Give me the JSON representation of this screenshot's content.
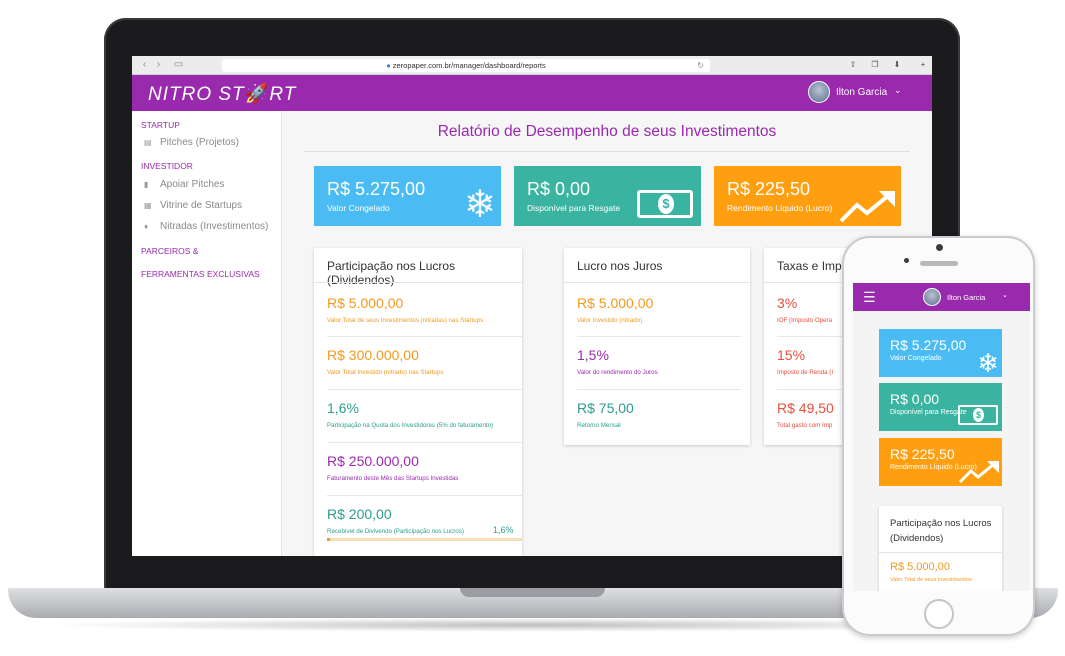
{
  "browser": {
    "url": "zeropaper.com.br/manager/dashboard/reports",
    "back_icon": "chevron-left",
    "forward_icon": "chevron-right"
  },
  "header": {
    "logo": "NITRO ST",
    "logo_rocket": "🚀",
    "logo_end": "RT",
    "user_name": "Ilton Garcia",
    "accent": "#9a2aad"
  },
  "sidebar": {
    "sections": [
      {
        "label": "STARTUP"
      },
      {
        "label": "INVESTIDOR"
      },
      {
        "label": "PARCEIROS &"
      },
      {
        "label": "FERRAMENTAS EXCLUSIVAS"
      }
    ],
    "items": [
      {
        "label": "Pitches (Projetos)",
        "icon": "document-icon"
      },
      {
        "label": "Apoiar Pitches",
        "icon": "thumbs-up-icon"
      },
      {
        "label": "Vitrine de Startups",
        "icon": "grid-icon"
      },
      {
        "label": "Nitradas (Investimentos)",
        "icon": "flame-icon"
      }
    ]
  },
  "main": {
    "title": "Relatório de Desempenho de seus Investimentos",
    "stat_cards": [
      {
        "value": "R$ 5.275,00",
        "label": "Valor Congelado",
        "color": "#4bbcf3",
        "icon": "snowflake-icon"
      },
      {
        "value": "R$ 0,00",
        "label": "Disponível para Resgate",
        "color": "#3bb3a1",
        "icon": "money-icon"
      },
      {
        "value": "R$ 225,50",
        "label": "Rendimento Líquido (Lucro)",
        "color": "#ff9f10",
        "icon": "trend-up-icon"
      }
    ],
    "panels": [
      {
        "title": "Participação nos Lucros (Dividendos)",
        "rows": [
          {
            "value": "R$ 5.000,00",
            "label": "Valor Total de seus Investimentos (nitradas) nas Startups"
          },
          {
            "value": "R$ 300.000,00",
            "label": "Valor Total Investido (nitrado) nas Startups"
          },
          {
            "value": "1,6%",
            "label": "Participação na Quota dos Investidores (5% do faturamento)"
          },
          {
            "value": "R$ 250.000,00",
            "label": "Faturamento deste Mês das Startups Investidas"
          },
          {
            "value": "R$ 200,00",
            "label": "Recebível de Divivendo (Participação nos Lucros)",
            "percent_text": "1,6%",
            "progress": 0.016
          }
        ]
      },
      {
        "title": "Lucro nos Juros",
        "rows": [
          {
            "value": "R$ 5.000,00",
            "label": "Valor Investido (nitrado)"
          },
          {
            "value": "1,5%",
            "label": "Valor do rendimento do Juros"
          },
          {
            "value": "R$ 75,00",
            "label": "Retorno Mensal"
          }
        ]
      },
      {
        "title": "Taxas e Imp",
        "rows": [
          {
            "value": "3%",
            "label": "IOF (Imposto Opera"
          },
          {
            "value": "15%",
            "label": "Imposto de Renda (I"
          },
          {
            "value": "R$ 49,50",
            "label": "Total gasto com Imp"
          }
        ]
      }
    ]
  },
  "phone": {
    "user_name": "Ilton Garcia",
    "cards": [
      {
        "value": "R$ 5.275,00",
        "label": "Valor Congelado",
        "color": "#4bbcf3",
        "icon": "snowflake-icon"
      },
      {
        "value": "R$ 0,00",
        "label": "Disponível para Resgate",
        "color": "#3bb3a1",
        "icon": "money-icon"
      },
      {
        "value": "R$ 225,50",
        "label": "Rendimento Líquido (Lucro)",
        "color": "#ff9f10",
        "icon": "trend-up-icon"
      }
    ],
    "panel": {
      "title": "Participação nos Lucros (Dividendos)",
      "value": "R$ 5.000,00",
      "label": "Valor Total de seus Investimentos"
    }
  }
}
